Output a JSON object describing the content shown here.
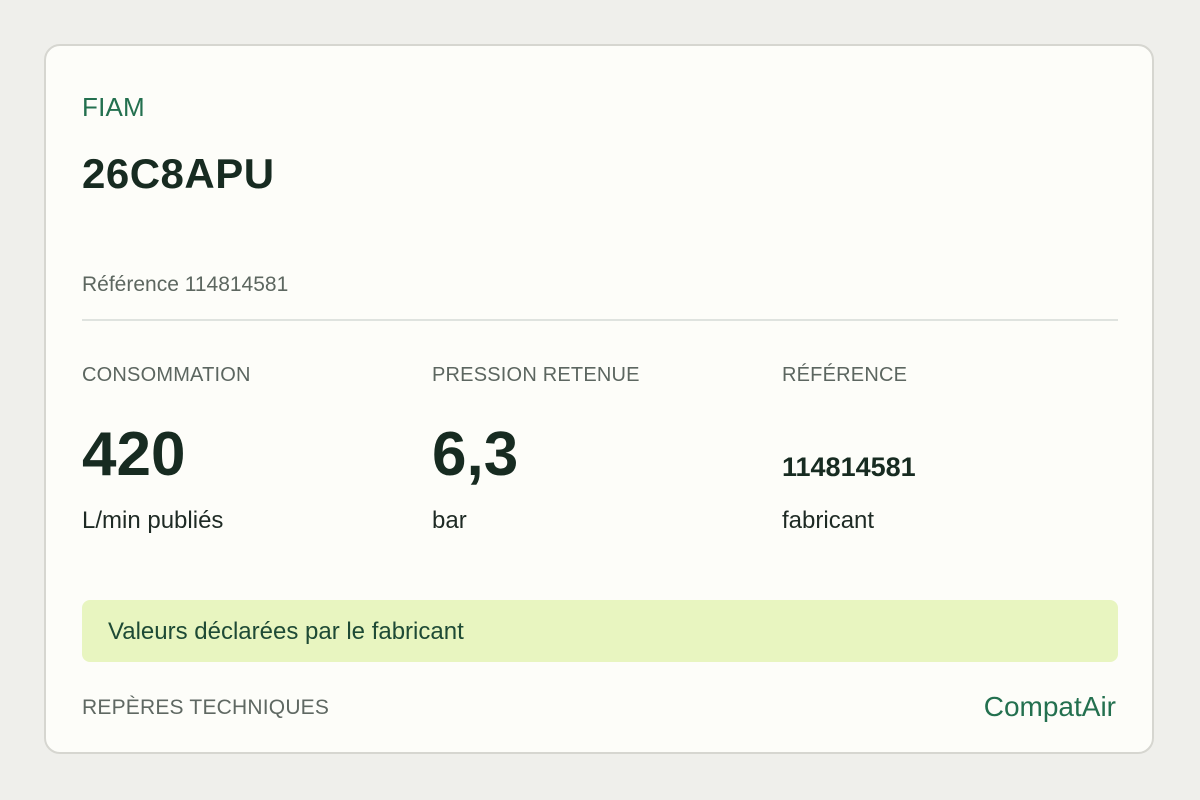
{
  "product": {
    "brand": "FIAM",
    "model": "26C8APU",
    "reference_line": "Référence 114814581"
  },
  "stats": [
    {
      "label": "CONSOMMATION",
      "value": "420",
      "unit": "L/min publiés"
    },
    {
      "label": "PRESSION RETENUE",
      "value": "6,3",
      "unit": "bar"
    },
    {
      "label": "RÉFÉRENCE",
      "value": "114814581",
      "unit": "fabricant"
    }
  ],
  "banner": {
    "text": "Valeurs déclarées par le fabricant"
  },
  "footer": {
    "section_label": "REPÈRES TECHNIQUES",
    "brand": "CompatAir"
  },
  "colors": {
    "accent": "#23704f",
    "banner_bg": "#e8f5c0",
    "card_bg": "#fdfdf9",
    "page_bg": "#efefeb"
  }
}
